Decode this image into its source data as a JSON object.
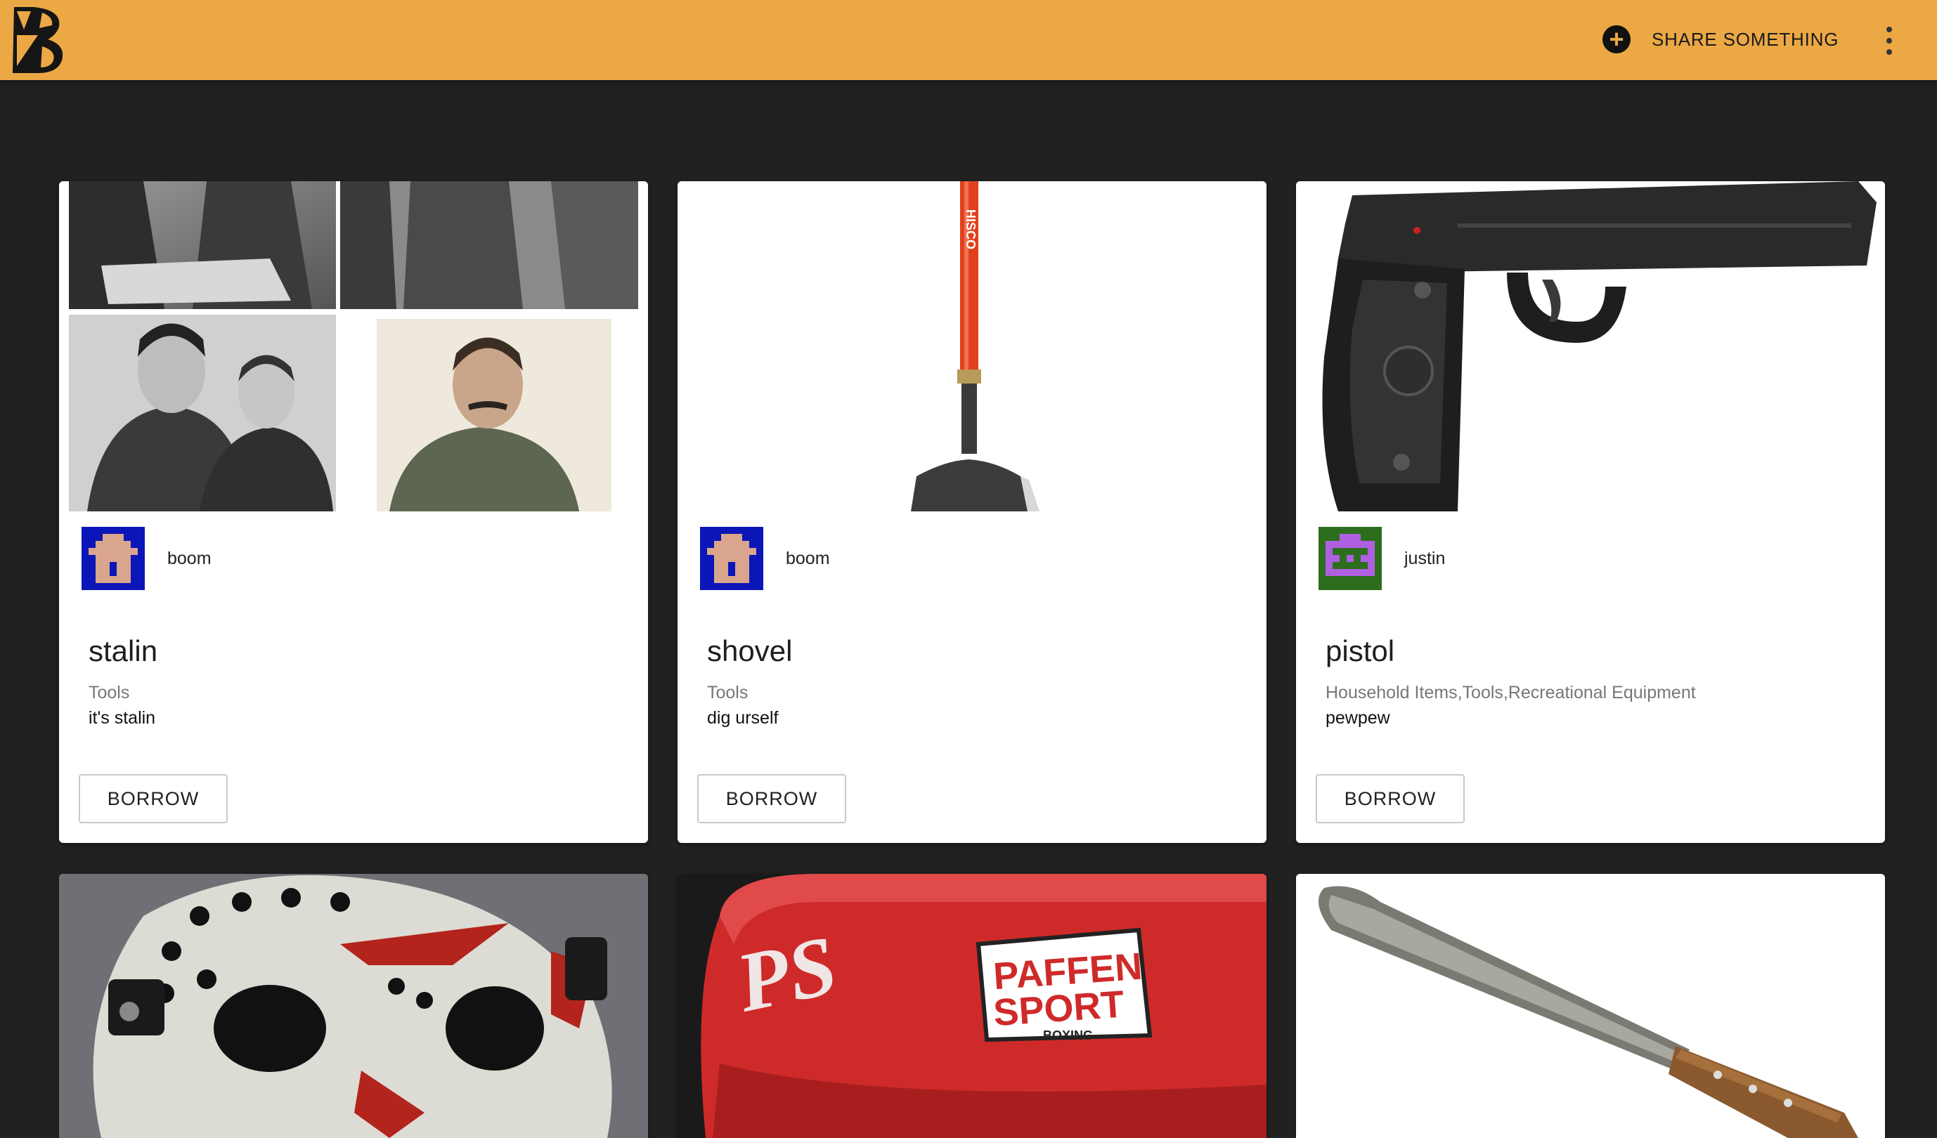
{
  "app": {
    "share_label": "SHARE SOMETHING",
    "accent": "#eba844",
    "background": "#212121"
  },
  "items": [
    {
      "title": "stalin",
      "owner": "boom",
      "tags": "Tools",
      "description": "it's stalin",
      "borrow_label": "BORROW",
      "image": "photo-collage",
      "avatar": "pixel-avatar-blue"
    },
    {
      "title": "shovel",
      "owner": "boom",
      "tags": "Tools",
      "description": "dig urself",
      "borrow_label": "BORROW",
      "image": "shovel-photo",
      "avatar": "pixel-avatar-blue"
    },
    {
      "title": "pistol",
      "owner": "justin",
      "tags": "Household Items,Tools,Recreational Equipment",
      "description": "pewpew",
      "borrow_label": "BORROW",
      "image": "pistol-photo",
      "avatar": "pixel-avatar-green"
    },
    {
      "image": "hockey-mask-photo"
    },
    {
      "image": "boxing-gear-photo"
    },
    {
      "image": "machete-photo"
    }
  ],
  "boxing_brand": {
    "line1": "PAFFEN",
    "line2": "SPORT",
    "line3": "BOXING"
  }
}
